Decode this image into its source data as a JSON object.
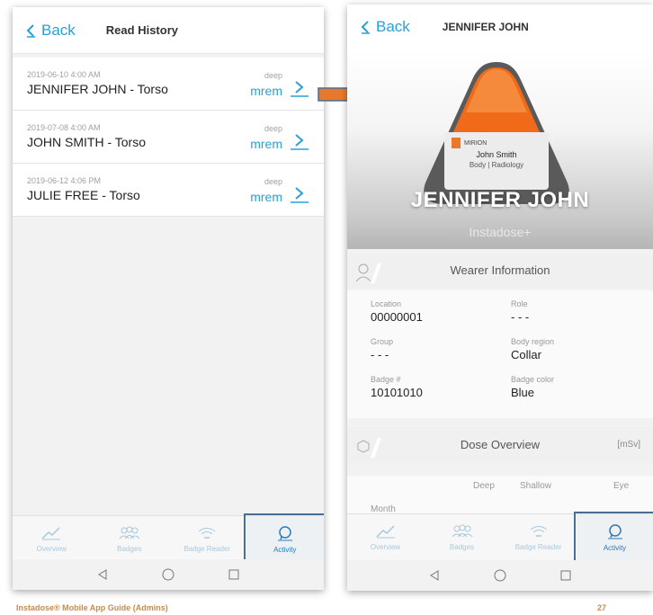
{
  "left_screen": {
    "back_label": "Back",
    "title": "Read History",
    "rows": [
      {
        "date": "2019-06-10 4:00 AM",
        "name": "JENNIFER JOHN - Torso",
        "dose_type": "deep",
        "unit": "mrem"
      },
      {
        "date": "2019-07-08 4:00 AM",
        "name": "JOHN SMITH - Torso",
        "dose_type": "deep",
        "unit": "mrem"
      },
      {
        "date": "2019-06-12 4:06 PM",
        "name": "JULIE FREE - Torso",
        "dose_type": "deep",
        "unit": "mrem"
      }
    ]
  },
  "right_screen": {
    "back_label": "Back",
    "title": "JENNIFER JOHN",
    "badge_card": {
      "brand": "MIRION",
      "wearer": "John Smith",
      "line2": "Body | Radiology"
    },
    "hero_name": "JENNIFER JOHN",
    "hero_subtitle": "Instadose+",
    "wearer_section_title": "Wearer Information",
    "fields": {
      "location_label": "Location",
      "location_value": "00000001",
      "role_label": "Role",
      "role_value": "- - -",
      "group_label": "Group",
      "group_value": "- - -",
      "body_region_label": "Body region",
      "body_region_value": "Collar",
      "badge_label": "Badge #",
      "badge_value": "10101010",
      "badge_color_label": "Badge color",
      "badge_color_value": "Blue"
    },
    "dose_section_title": "Dose Overview",
    "dose_unit": "[mSv]",
    "dose_columns": [
      "Deep",
      "Shallow",
      "Eye"
    ],
    "month_label": "Month"
  },
  "nav": {
    "items": [
      {
        "label": "Overview",
        "icon": "trend-line-icon"
      },
      {
        "label": "Badges",
        "icon": "people-group-icon"
      },
      {
        "label": "Badge Reader",
        "icon": "wifi-signal-icon"
      },
      {
        "label": "Activity",
        "icon": "speech-bubble-icon"
      }
    ],
    "active": "Activity"
  },
  "footer": {
    "left": "Instadose® Mobile App Guide (Admins)",
    "page": "27"
  },
  "colors": {
    "accent": "#2a9fd8",
    "arrow": "#e8782a",
    "badge_orange": "#f06a1a",
    "highlight_box": "#4a6f96"
  }
}
